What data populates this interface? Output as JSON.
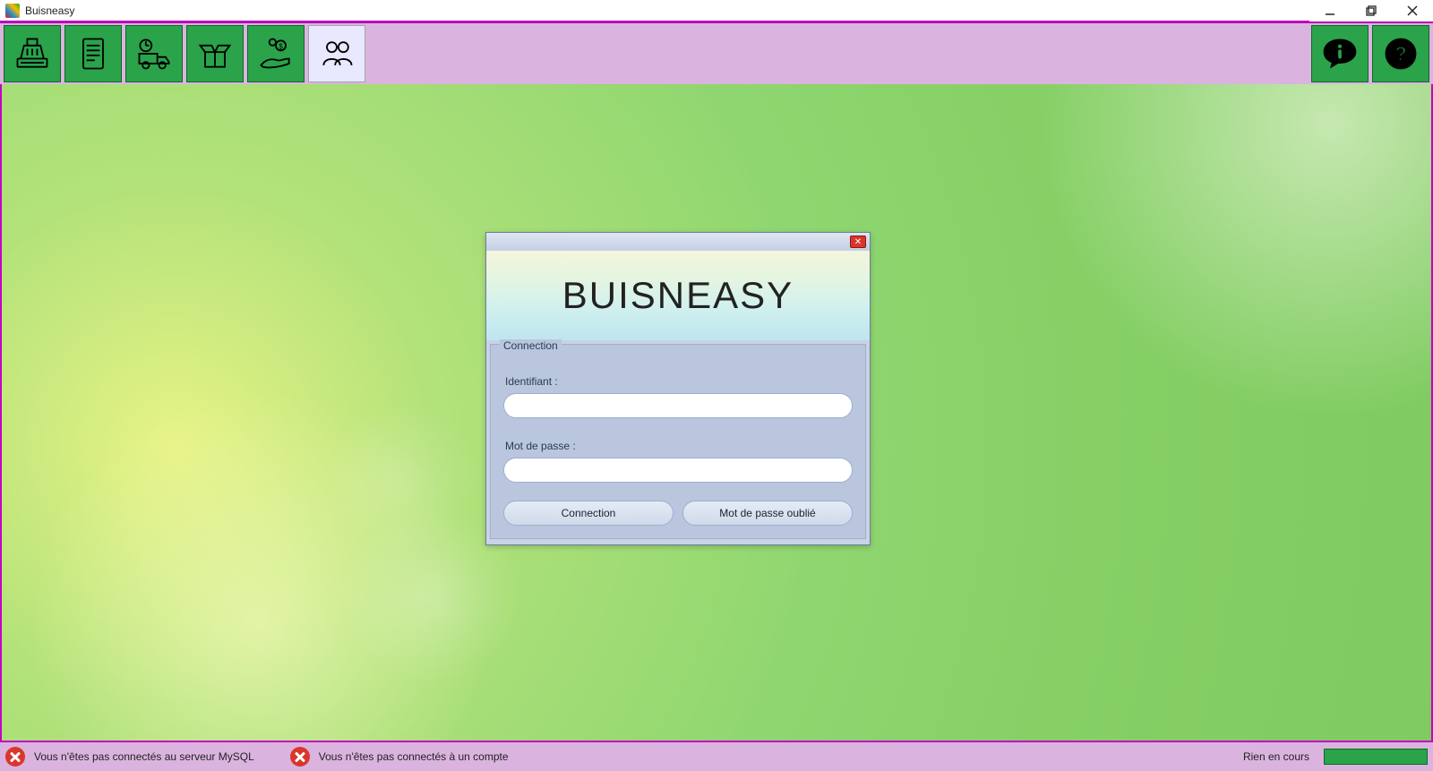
{
  "window": {
    "title": "Buisneasy"
  },
  "toolbar": {
    "buttons": [
      "cash",
      "doc",
      "delivery",
      "box",
      "money",
      "users",
      "info",
      "help"
    ]
  },
  "login": {
    "banner": "BUISNEASY",
    "group_legend": "Connection",
    "id_label": "Identifiant :",
    "pw_label": "Mot de passe :",
    "id_value": "",
    "pw_value": "",
    "connect_btn": "Connection",
    "forgot_btn": "Mot de passe oublié"
  },
  "status": {
    "mysql_msg": "Vous n'êtes pas connectés au serveur MySQL",
    "account_msg": "Vous n'êtes pas connectés à un compte",
    "right_label": "Rien en cours"
  }
}
